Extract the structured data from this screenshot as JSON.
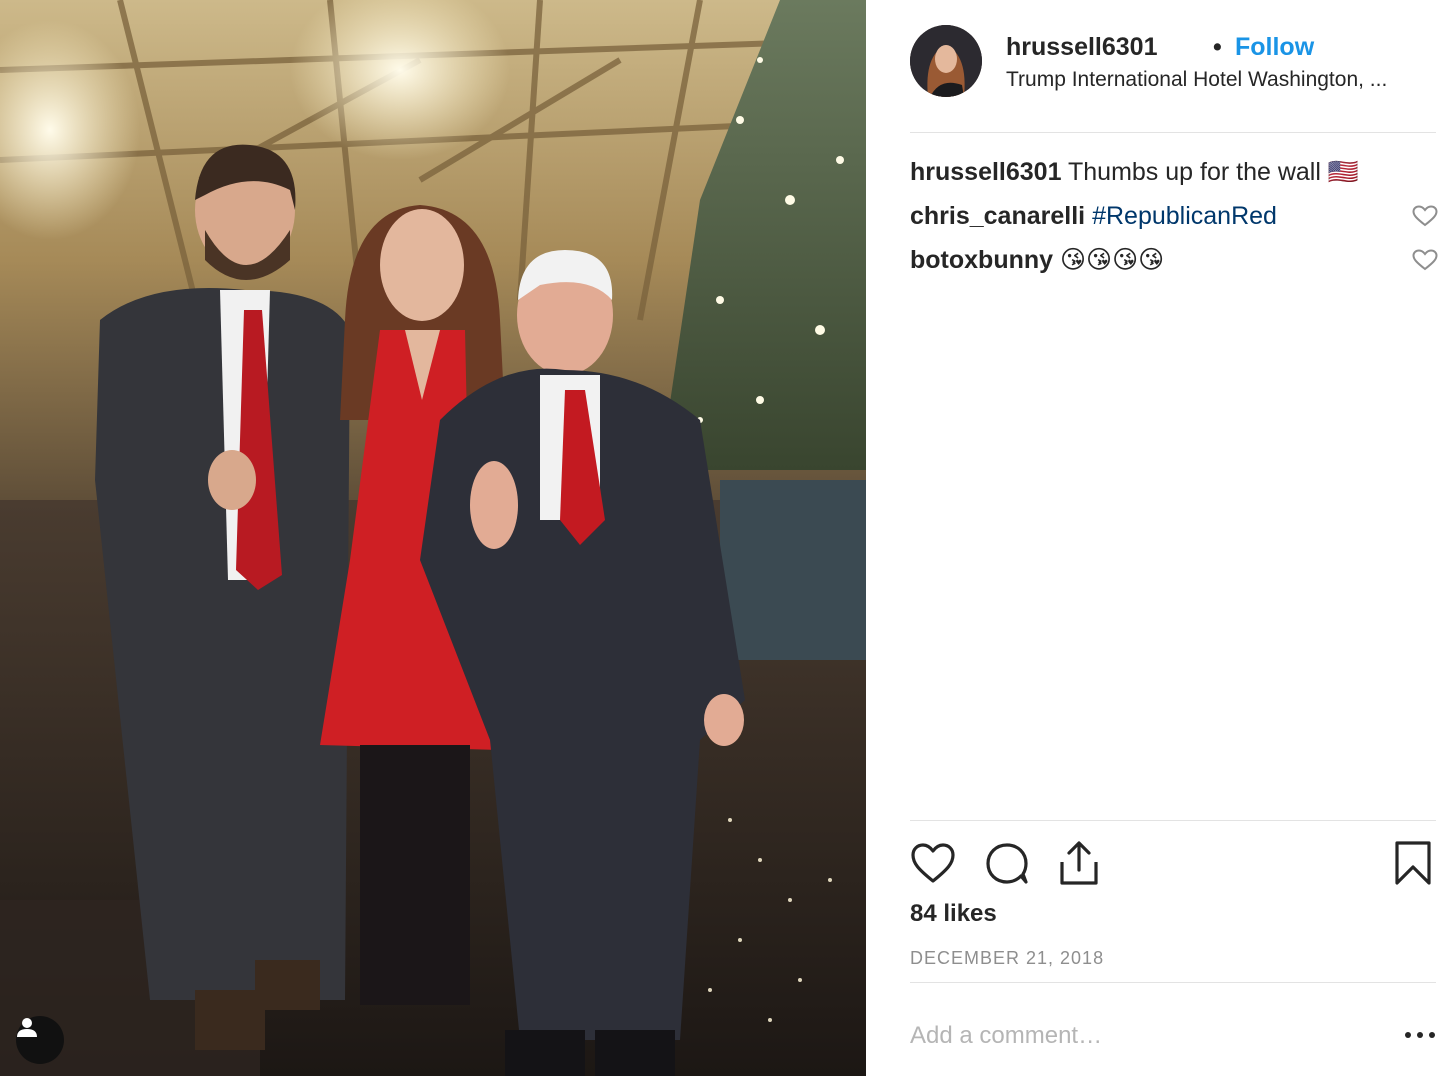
{
  "post": {
    "username": "hrussell6301",
    "separator": "•",
    "follow_label": "Follow",
    "location": "Trump International Hotel Washington, ...",
    "caption": {
      "user": "hrussell6301",
      "text": "Thumbs up for the wall 🇺🇸"
    },
    "comments": [
      {
        "user": "chris_canarelli",
        "text": "#RepublicanRed"
      },
      {
        "user": "botoxbunny",
        "text": "😘😘😘😘"
      }
    ],
    "likes": "84 likes",
    "date": "DECEMBER 21, 2018",
    "comment_placeholder": "Add a comment…",
    "more_label": "•••"
  },
  "icons": {
    "like": "heart-icon",
    "comment": "comment-bubble-icon",
    "share": "share-icon",
    "save": "bookmark-icon",
    "tags": "user-tag-icon"
  },
  "colors": {
    "follow": "#1a94e6",
    "hashtag": "#00376b",
    "muted": "#8e8e8e"
  }
}
